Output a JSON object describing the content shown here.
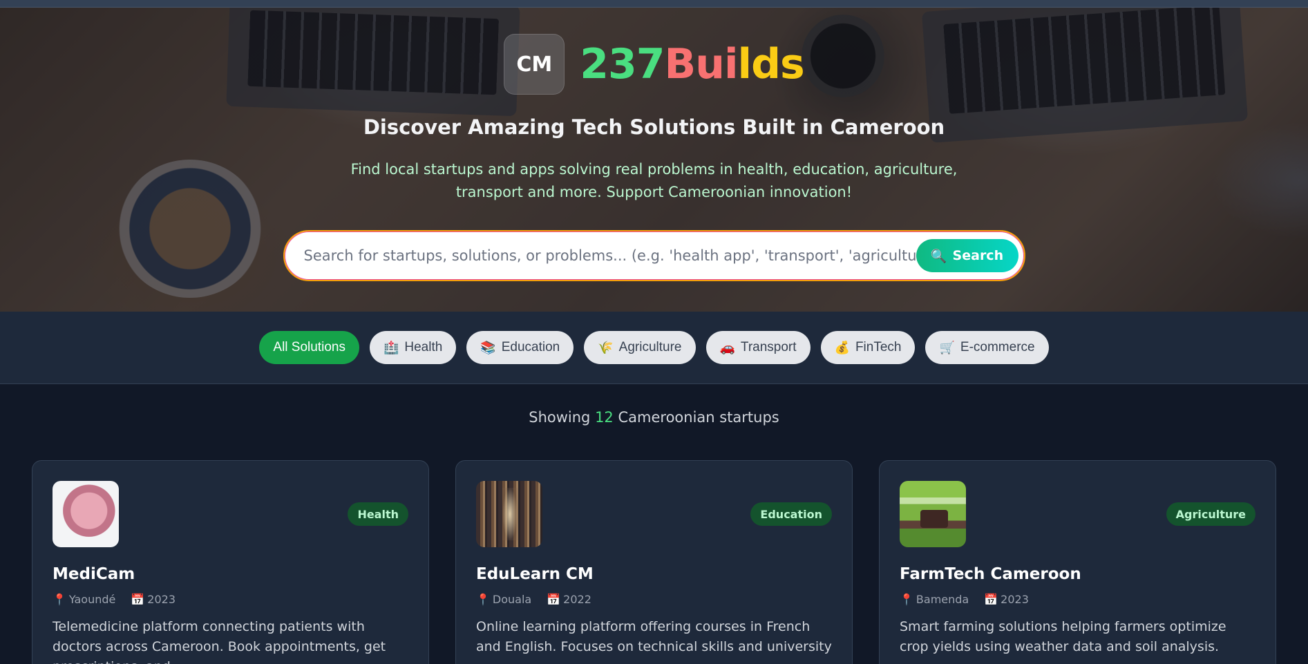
{
  "brand": {
    "logo_text": "CM",
    "name_part1": "237",
    "name_part2": "Bui",
    "name_part3": "lds"
  },
  "hero": {
    "subtitle": "Discover Amazing Tech Solutions Built in Cameroon",
    "description_line1": "Find local startups and apps solving real problems in health, education, agriculture,",
    "description_line2": "transport and more. Support Cameroonian innovation!"
  },
  "search": {
    "placeholder": "Search for startups, solutions, or problems... (e.g. 'health app', 'transport', 'agriculture')",
    "button_label": "Search",
    "button_icon": "🔍"
  },
  "filters": [
    {
      "label": "All Solutions",
      "icon": ""
    },
    {
      "label": "Health",
      "icon": "🏥"
    },
    {
      "label": "Education",
      "icon": "📚"
    },
    {
      "label": "Agriculture",
      "icon": "🌾"
    },
    {
      "label": "Transport",
      "icon": "🚗"
    },
    {
      "label": "FinTech",
      "icon": "💰"
    },
    {
      "label": "E-commerce",
      "icon": "🛒"
    }
  ],
  "results": {
    "prefix": "Showing",
    "count": "12",
    "suffix": "Cameroonian startups"
  },
  "cards": [
    {
      "title": "MediCam",
      "category": "Health",
      "location": "Yaoundé",
      "year": "2023",
      "description": "Telemedicine platform connecting patients with doctors across Cameroon. Book appointments, get prescriptions, and"
    },
    {
      "title": "EduLearn CM",
      "category": "Education",
      "location": "Douala",
      "year": "2022",
      "description": "Online learning platform offering courses in French and English. Focuses on technical skills and university"
    },
    {
      "title": "FarmTech Cameroon",
      "category": "Agriculture",
      "location": "Bamenda",
      "year": "2023",
      "description": "Smart farming solutions helping farmers optimize crop yields using weather data and soil analysis."
    }
  ],
  "icons": {
    "location": "📍",
    "calendar": "📅"
  },
  "colors": {
    "accent_green": "#16a34a",
    "brand_green": "#4ade80",
    "brand_red": "#f87171",
    "brand_yellow": "#facc15",
    "background": "#111827",
    "card_bg": "#1e293b"
  }
}
